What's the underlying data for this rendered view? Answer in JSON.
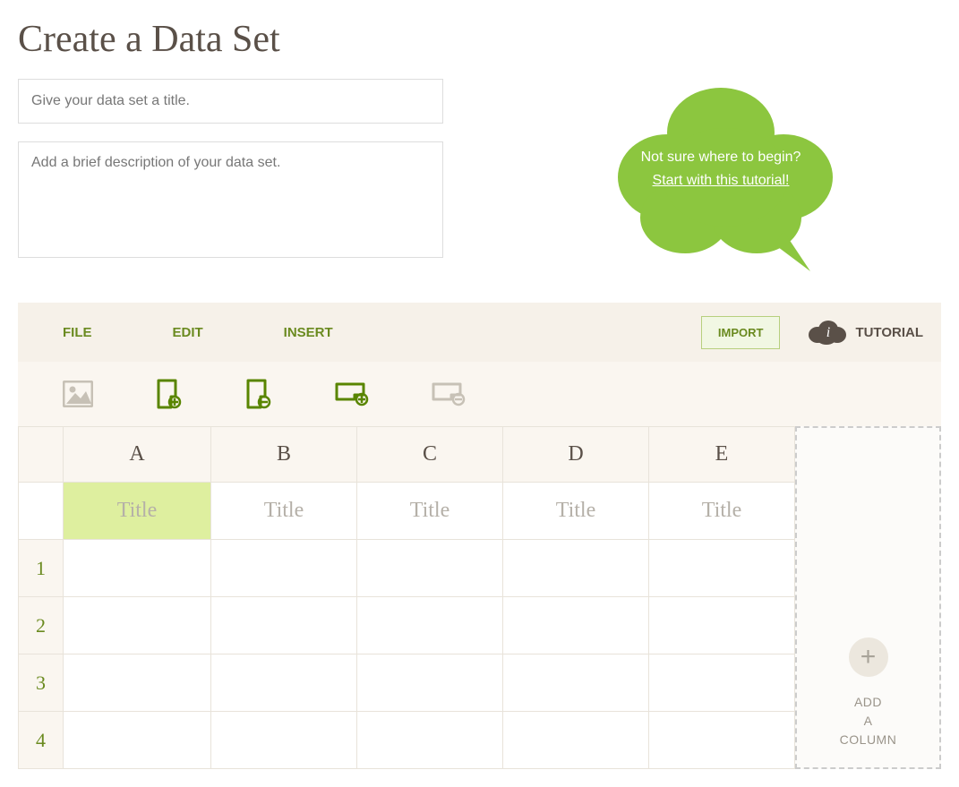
{
  "page": {
    "title": "Create a Data Set"
  },
  "inputs": {
    "title_placeholder": "Give your data set a title.",
    "desc_placeholder": "Add a brief description of your data set."
  },
  "bubble": {
    "line1": "Not sure where to begin?",
    "link": "Start with this tutorial!"
  },
  "menu": {
    "file": "FILE",
    "edit": "EDIT",
    "insert": "INSERT",
    "import": "IMPORT",
    "tutorial": "TUTORIAL"
  },
  "columns": [
    "A",
    "B",
    "C",
    "D",
    "E"
  ],
  "title_cells": [
    "Title",
    "Title",
    "Title",
    "Title",
    "Title"
  ],
  "rows": [
    "1",
    "2",
    "3",
    "4"
  ],
  "add_column": {
    "line1": "ADD",
    "line2": "A",
    "line3": "COLUMN"
  }
}
